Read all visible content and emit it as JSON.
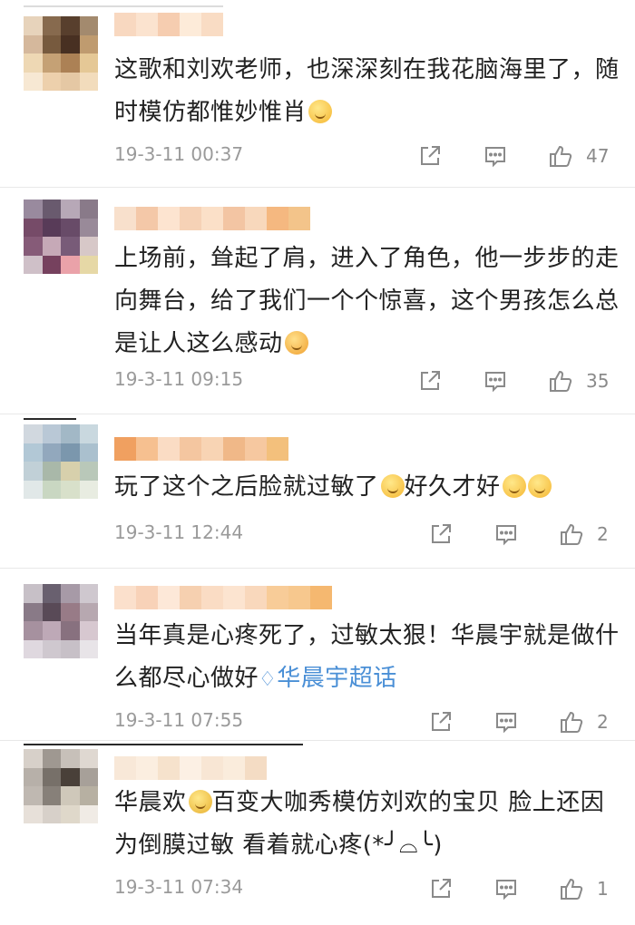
{
  "comments": [
    {
      "text": "这歌和刘欢老师，也深深刻在我花脑海里了，随时模仿都惟妙惟肖",
      "emoji": "laughing-crying-emoji",
      "time": "19-3-11 00:37",
      "likes": "47"
    },
    {
      "text": "上场前，耸起了肩，进入了角色，他一步步的走向舞台，给了我们一个个惊喜，这个男孩怎么总是让人这么感动",
      "emoji": "touched-emoji",
      "time": "19-3-11 09:15",
      "likes": "35"
    },
    {
      "text_a": "玩了这个之后脸就过敏了",
      "text_b": "好久才好",
      "time": "19-3-11 12:44",
      "likes": "2"
    },
    {
      "text": "当年真是心疼死了，过敏太狠！华晨宇就是做什么都尽心做好",
      "topic_icon": "diamond-topic-icon",
      "topic": "华晨宇超话",
      "time": "19-3-11 07:55",
      "likes": "2"
    },
    {
      "text_a": "华晨欢",
      "text_b": "百变大咖秀模仿刘欢的宝贝 脸上还因为倒膜过敏 看着就心疼(*╯⌓╰)",
      "time": "19-3-11 07:34",
      "likes": "1"
    }
  ],
  "icons": {
    "repost": "repost-icon",
    "comment": "comment-icon",
    "like": "thumbs-up-icon"
  },
  "colors": {
    "text": "#222222",
    "meta": "#9a9a9a",
    "link": "#4a8fd6"
  }
}
